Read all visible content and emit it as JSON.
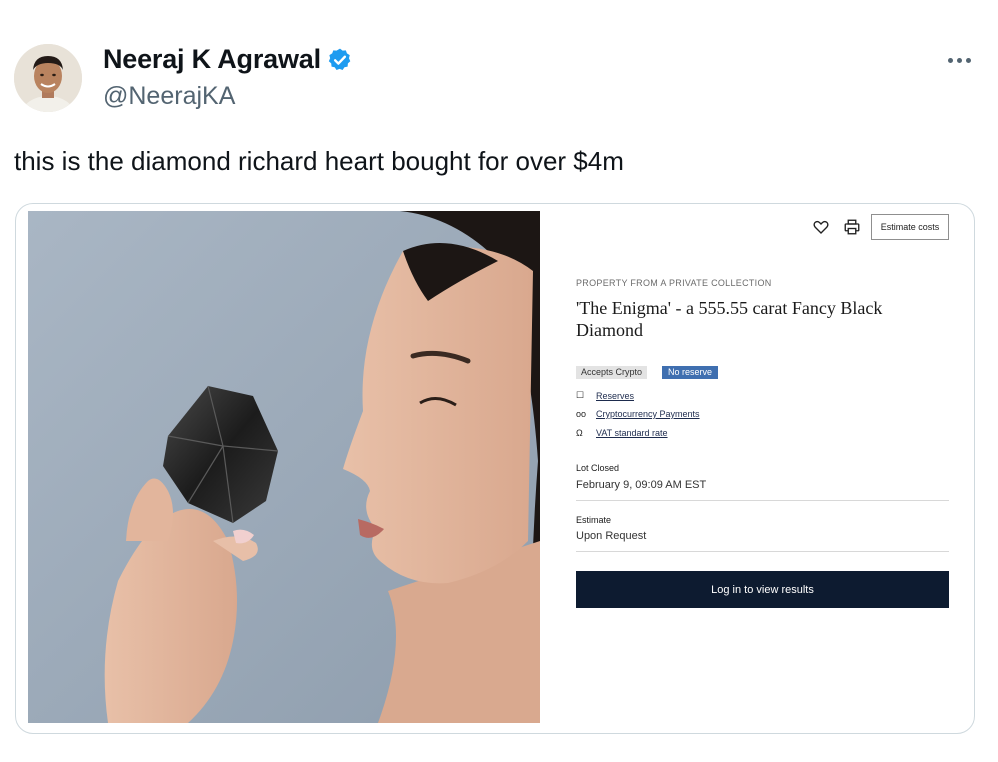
{
  "author": {
    "display_name": "Neeraj K Agrawal",
    "handle": "@NeerajKA",
    "verified_icon": "verified-badge-icon"
  },
  "tweet": {
    "text": "this is the diamond richard heart bought for over $4m"
  },
  "listing": {
    "estimate_costs_label": "Estimate costs",
    "eyebrow": "PROPERTY FROM A PRIVATE COLLECTION",
    "title": "'The Enigma' - a 555.55 carat Fancy Black Diamond",
    "tags": [
      "Accepts Crypto",
      "No reserve"
    ],
    "links": [
      {
        "icon": "square-icon",
        "glyph": "☐",
        "label": "Reserves"
      },
      {
        "icon": "glasses-icon",
        "glyph": "oo",
        "label": "Cryptocurrency Payments"
      },
      {
        "icon": "omega-icon",
        "glyph": "Ω",
        "label": "VAT standard rate"
      }
    ],
    "lot_closed_label": "Lot Closed",
    "lot_closed_value": "February 9, 09:09 AM EST",
    "estimate_label": "Estimate",
    "estimate_value": "Upon Request",
    "login_label": "Log in to view results"
  },
  "colors": {
    "verified_blue": "#1d9bf0",
    "no_reserve_tag": "#3f6fb0",
    "login_button": "#0d1b30"
  }
}
